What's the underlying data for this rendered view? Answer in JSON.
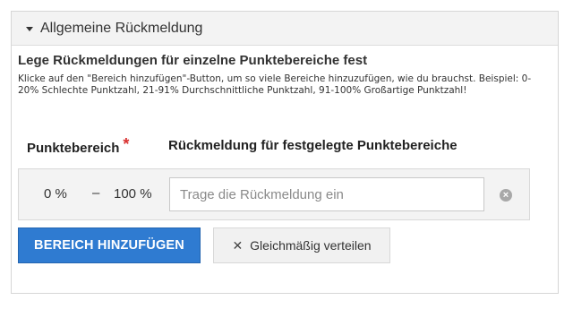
{
  "panel": {
    "title": "Allgemeine Rückmeldung"
  },
  "section": {
    "title": "Lege Rückmeldungen für einzelne Punktebereiche fest",
    "hint": "Klicke auf den \"Bereich hinzufügen\"-Button, um so viele Bereiche hinzuzufügen, wie du brauchst. Beispiel: 0-20% Schlechte Punktzahl, 21-91% Durchschnittliche Punktzahl, 91-100% Großartige Punktzahl!"
  },
  "columns": {
    "range_label": "Punktebereich",
    "required_mark": "*",
    "feedback_label": "Rückmeldung für festgelegte Punktebereiche"
  },
  "range_row": {
    "from": "0 %",
    "separator": "–",
    "to": "100 %",
    "feedback_value": "",
    "feedback_placeholder": "Trage die Rückmeldung ein",
    "clear_glyph": "×"
  },
  "actions": {
    "add_label": "BEREICH HINZUFÜGEN",
    "distribute_glyph": "✕",
    "distribute_label": "Gleichmäßig verteilen"
  },
  "colors": {
    "primary": "#2f7bd1",
    "required": "#d9302f"
  }
}
